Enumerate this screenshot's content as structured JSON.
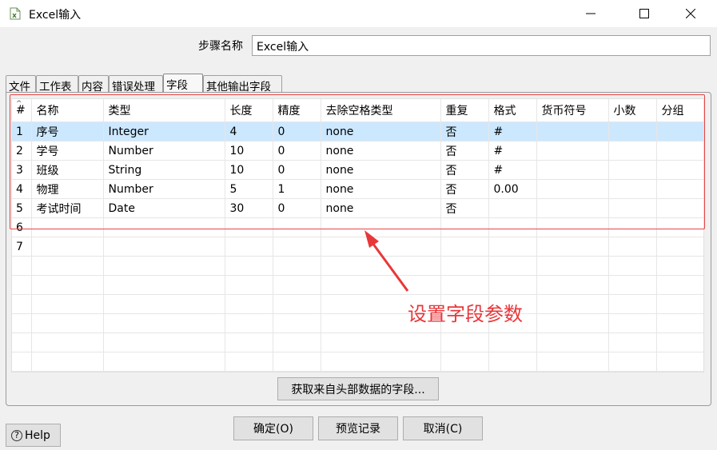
{
  "window": {
    "title": "Excel输入"
  },
  "step": {
    "label": "步骤名称",
    "value": "Excel输入"
  },
  "tabs": [
    {
      "label": "文件"
    },
    {
      "label": "工作表"
    },
    {
      "label": "内容"
    },
    {
      "label": "错误处理"
    },
    {
      "label": "字段"
    },
    {
      "label": "其他输出字段"
    }
  ],
  "active_tab": "字段",
  "grid": {
    "columns": [
      "#",
      "名称",
      "类型",
      "长度",
      "精度",
      "去除空格类型",
      "重复",
      "格式",
      "货币符号",
      "小数",
      "分组"
    ],
    "rows": [
      [
        "1",
        "序号",
        "Integer",
        "4",
        "0",
        "none",
        "否",
        "#",
        "",
        "",
        ""
      ],
      [
        "2",
        "学号",
        "Number",
        "10",
        "0",
        "none",
        "否",
        "#",
        "",
        "",
        ""
      ],
      [
        "3",
        "班级",
        "String",
        "10",
        "0",
        "none",
        "否",
        "#",
        "",
        "",
        ""
      ],
      [
        "4",
        "物理",
        "Number",
        "5",
        "1",
        "none",
        "否",
        "0.00",
        "",
        "",
        ""
      ],
      [
        "5",
        "考试时间",
        "Date",
        "30",
        "0",
        "none",
        "否",
        "",
        "",
        "",
        ""
      ],
      [
        "6",
        "",
        "",
        "",
        "",
        "",
        "",
        "",
        "",
        "",
        ""
      ],
      [
        "7",
        "",
        "",
        "",
        "",
        "",
        "",
        "",
        "",
        "",
        ""
      ]
    ],
    "selected_row": 1
  },
  "annotation": {
    "text": "设置字段参数",
    "color": "#e8373a"
  },
  "buttons": {
    "get_fields": "获取来自头部数据的字段...",
    "ok": "确定(O)",
    "preview": "预览记录",
    "cancel": "取消(C)",
    "help": "Help"
  },
  "icons": {
    "app": "excel-input-step-icon",
    "minimize": "minimize-icon",
    "maximize": "maximize-icon",
    "close": "close-icon",
    "help": "help-circle-icon"
  }
}
